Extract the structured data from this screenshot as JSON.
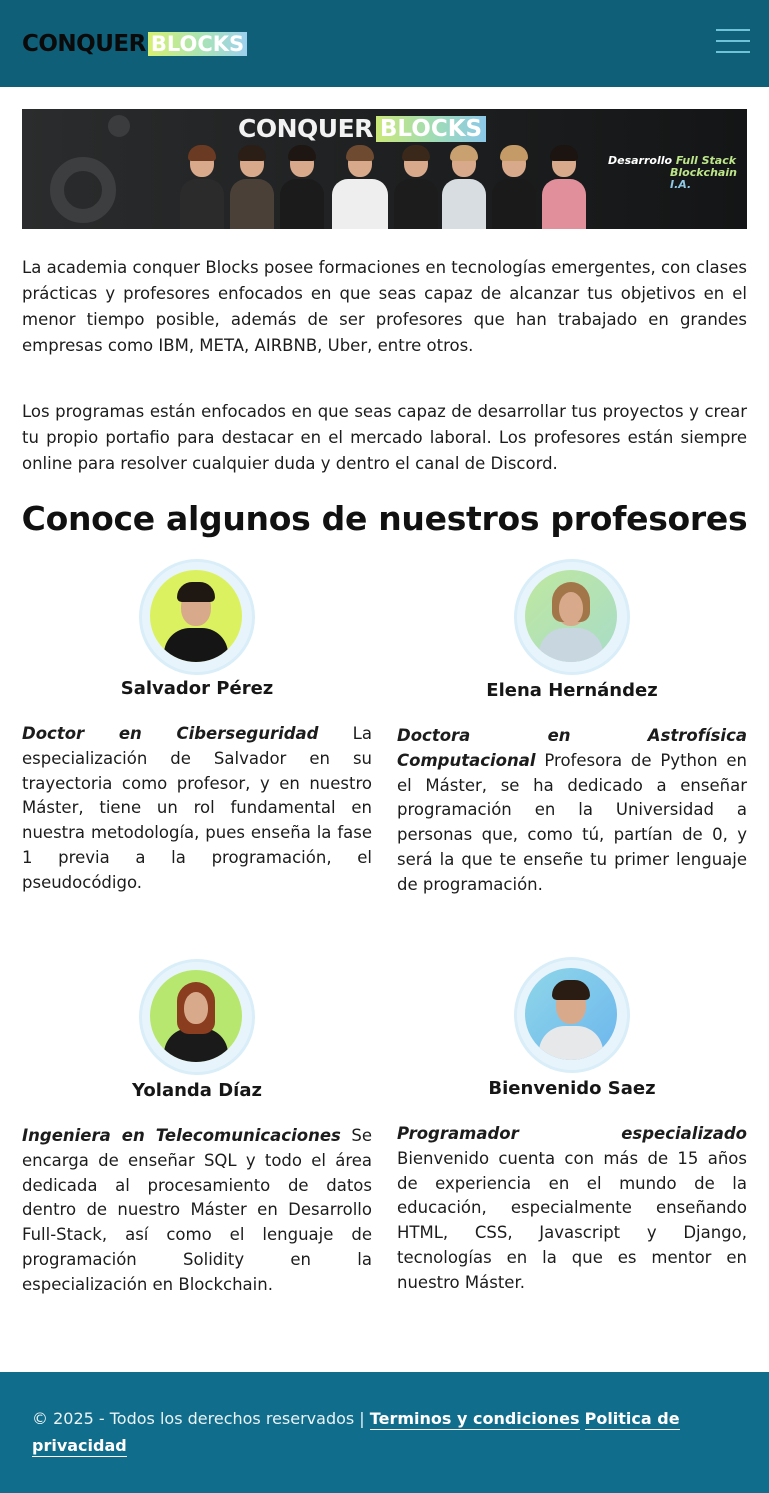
{
  "header": {
    "logo_word1": "CONQUER",
    "logo_word2": "BLOCKS",
    "menu_icon": "hamburger-menu-icon",
    "background_color": "#0f5f79"
  },
  "banner": {
    "logo_word1": "CONQUER",
    "logo_word2": "BLOCKS",
    "tag_prefix": "Desarrollo",
    "tag_highlight": "Full Stack",
    "tag_line2": "Blockchain",
    "tag_line3": "I.A."
  },
  "intro": {
    "paragraph1": "La academia conquer Blocks posee formaciones en tecnologías emergentes, con clases prácticas y profesores enfocados en que seas capaz de alcanzar tus objetivos en el menor tiempo posible, además de ser profesores que han trabajado en grandes empresas como IBM, META, AIRBNB, Uber, entre otros.",
    "paragraph2": "Los programas están enfocados en que seas capaz de desarrollar tus proyectos y crear tu propio portafio para destacar en el mercado laboral. Los profesores están siempre online para resolver cualquier duda y dentro el canal de Discord."
  },
  "section_title": "Conoce algunos de nuestros profesores",
  "teachers": [
    {
      "name": "Salvador Pérez",
      "role": "Doctor en Ciberseguridad",
      "description": " La especialización de Salvador en su trayectoria como profesor, y en nuestro Máster, tiene un rol fundamental en nuestra metodología, pues enseña la fase 1 previa a la programación, el pseudocódigo."
    },
    {
      "name": "Elena Hernández",
      "role": "Doctora en Astrofísica Computacional",
      "description": " Profesora de Python en el Máster, se ha dedicado a enseñar programación en la Universidad a personas que, como tú, partían de 0, y será la que te enseñe tu primer lenguaje de programación."
    },
    {
      "name": "Yolanda Díaz",
      "role": "Ingeniera en Telecomunicaciones",
      "description": " Se encarga de enseñar SQL y todo el área dedicada al procesamiento de datos dentro de nuestro Máster en Desarrollo Full-Stack, así como el lenguaje de programación Solidity en la especialización en Blockchain."
    },
    {
      "name": "Bienvenido Saez",
      "role": "Programador especializado",
      "description": " Bienvenido cuenta con más de 15 años de experiencia en el mundo de la educación, especialmente enseñando HTML, CSS, Javascript y Django, tecnologías en la que es mentor en nuestro Máster."
    }
  ],
  "footer": {
    "copyright": "© 2025 - Todos los derechos reservados |",
    "terms_link": "Terminos y condiciones",
    "privacy_link": "Politica de privacidad",
    "background_color": "#116d8c"
  }
}
